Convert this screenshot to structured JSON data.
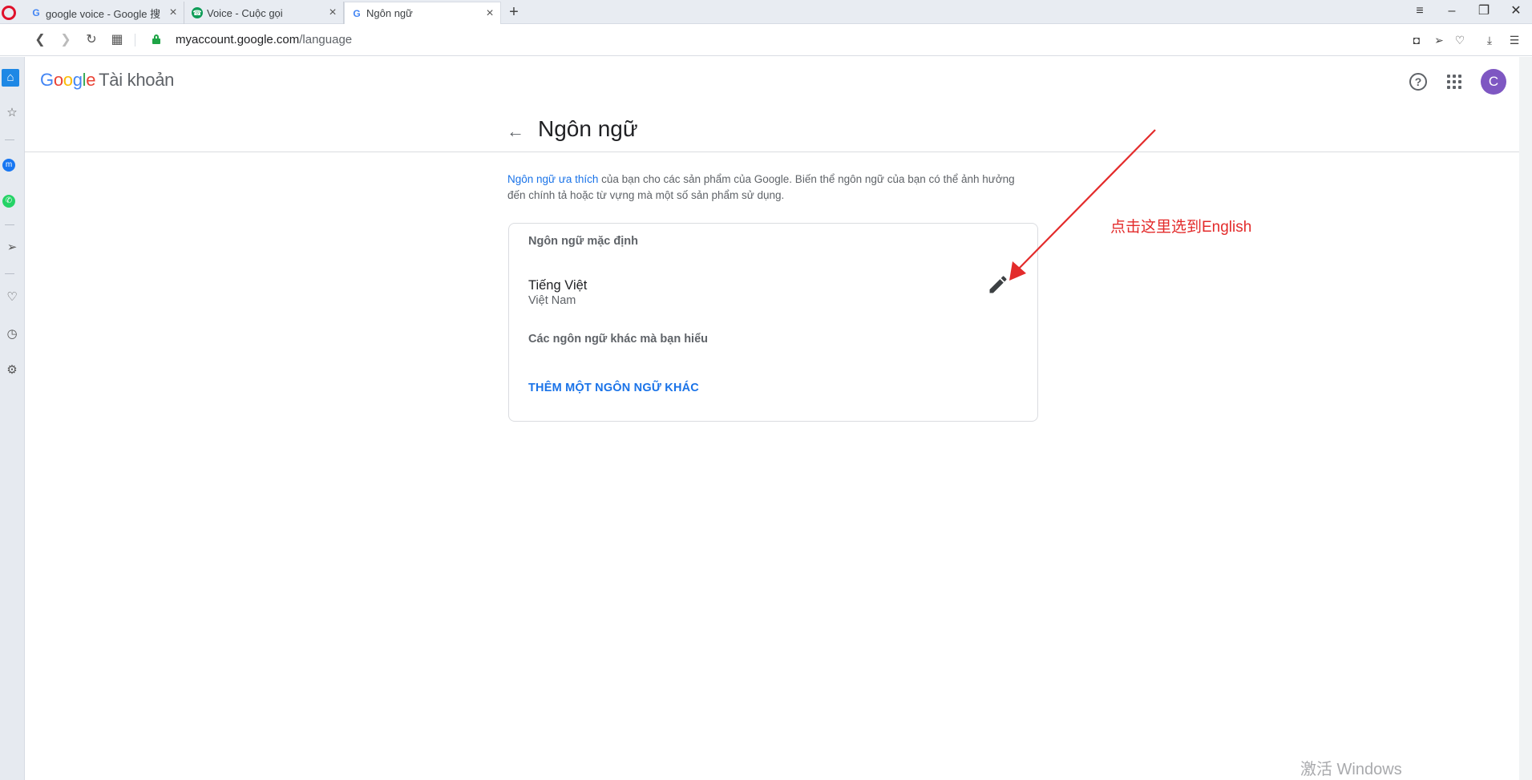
{
  "browser": {
    "tabs": [
      {
        "title": "google voice - Google 搜",
        "favicon": "google-g-icon",
        "active": false
      },
      {
        "title": "Voice - Cuộc gọi",
        "favicon": "google-voice-icon",
        "active": false
      },
      {
        "title": "Ngôn ngữ",
        "favicon": "google-g-icon",
        "active": true
      }
    ],
    "new_tab_label": "+",
    "url_host": "myaccount.google.com",
    "url_path": "/language"
  },
  "header": {
    "brand_letters": [
      "G",
      "o",
      "o",
      "g",
      "l",
      "e"
    ],
    "brand_sub": "Tài khoản",
    "avatar_letter": "C",
    "help_glyph": "?"
  },
  "page": {
    "title": "Ngôn ngữ",
    "intro_link": "Ngôn ngữ ưa thích",
    "intro_text": " của bạn cho các sản phẩm của Google. Biến thể ngôn ngữ của bạn có thể ảnh hưởng đến chính tả hoặc từ vựng mà một số sản phẩm sử dụng."
  },
  "card": {
    "default_label": "Ngôn ngữ mặc định",
    "language_name": "Tiếng Việt",
    "language_region": "Việt Nam",
    "others_label": "Các ngôn ngữ khác mà bạn hiểu",
    "add_link": "THÊM MỘT NGÔN NGỮ KHÁC"
  },
  "annotation": {
    "text": "点击这里选到English",
    "color": "#e32b2b"
  },
  "watermark": "激活 Windows",
  "colors": {
    "accent": "#1a73e8",
    "avatar": "#7e57c2",
    "annotation": "#e32b2b"
  }
}
